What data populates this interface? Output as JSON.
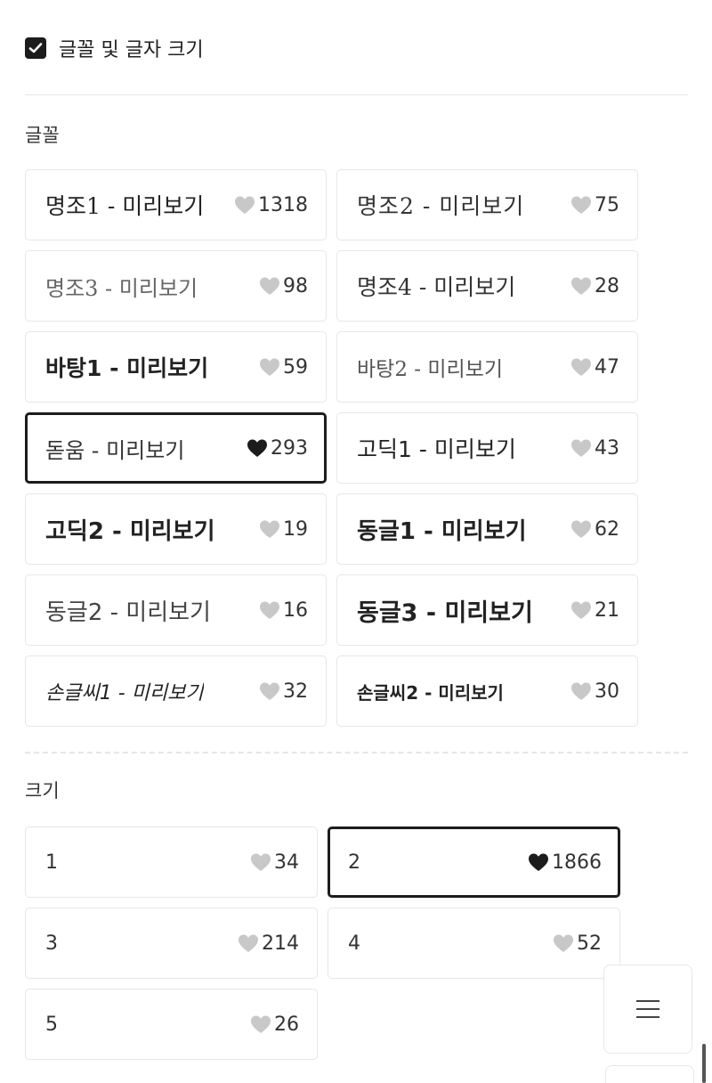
{
  "settings": {
    "checkbox_label": "글꼴 및 글자 크기",
    "checked": true
  },
  "fonts_section": {
    "title": "글꼴",
    "items": [
      {
        "label": "명조1 - 미리보기",
        "likes": "1318",
        "selected": false
      },
      {
        "label": "명조2 - 미리보기",
        "likes": "75",
        "selected": false
      },
      {
        "label": "명조3 - 미리보기",
        "likes": "98",
        "selected": false
      },
      {
        "label": "명조4 - 미리보기",
        "likes": "28",
        "selected": false
      },
      {
        "label": "바탕1 - 미리보기",
        "likes": "59",
        "selected": false
      },
      {
        "label": "바탕2 - 미리보기",
        "likes": "47",
        "selected": false
      },
      {
        "label": "돋움 - 미리보기",
        "likes": "293",
        "selected": true
      },
      {
        "label": "고딕1 - 미리보기",
        "likes": "43",
        "selected": false
      },
      {
        "label": "고딕2 - 미리보기",
        "likes": "19",
        "selected": false
      },
      {
        "label": "동글1 - 미리보기",
        "likes": "62",
        "selected": false
      },
      {
        "label": "동글2 - 미리보기",
        "likes": "16",
        "selected": false
      },
      {
        "label": "동글3 - 미리보기",
        "likes": "21",
        "selected": false
      },
      {
        "label": "손글씨1 - 미리보기",
        "likes": "32",
        "selected": false
      },
      {
        "label": "손글씨2 - 미리보기",
        "likes": "30",
        "selected": false
      }
    ]
  },
  "sizes_section": {
    "title": "크기",
    "items": [
      {
        "label": "1",
        "likes": "34",
        "selected": false
      },
      {
        "label": "2",
        "likes": "1866",
        "selected": true
      },
      {
        "label": "3",
        "likes": "214",
        "selected": false
      },
      {
        "label": "4",
        "likes": "52",
        "selected": false
      },
      {
        "label": "5",
        "likes": "26",
        "selected": false
      }
    ]
  },
  "icons": {
    "checkbox": "check-icon",
    "like": "heart-icon",
    "menu": "hamburger-menu-icon"
  },
  "colors": {
    "selected_border": "#1c1c1c",
    "card_border": "#e6e6e6",
    "heart_selected": "#1c1c1c",
    "heart_default": "#c8c8c8"
  }
}
